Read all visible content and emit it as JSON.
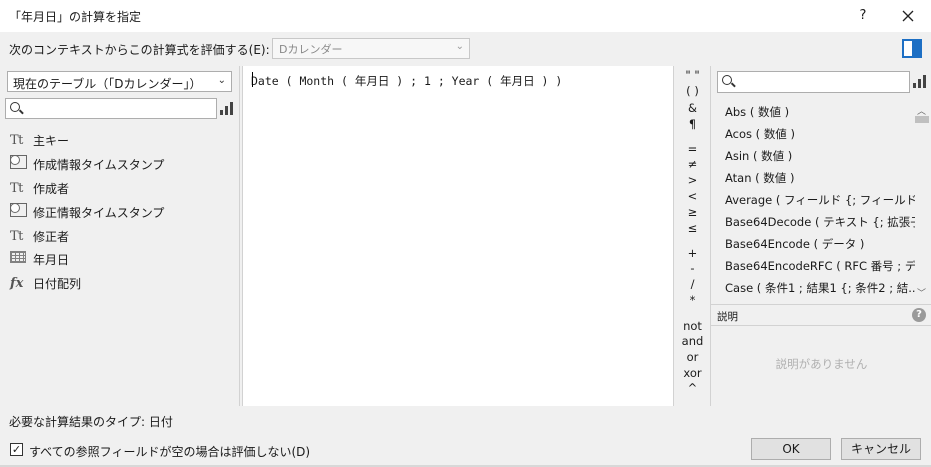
{
  "window": {
    "title": "「年月日」の計算を指定",
    "help_label": "?",
    "close_label": "✕"
  },
  "context": {
    "label": "次のコンテキストからこの計算式を評価する(E):",
    "value": "Dカレンダー"
  },
  "left_panel": {
    "table_select": "現在のテーブル（「Dカレンダー」）",
    "search_placeholder": "",
    "fields": [
      {
        "icon": "text-field-icon",
        "icon_text": "Tt",
        "label": "主キー"
      },
      {
        "icon": "timestamp-field-icon",
        "icon_text": "",
        "label": "作成情報タイムスタンプ"
      },
      {
        "icon": "text-field-icon",
        "icon_text": "Tt",
        "label": "作成者"
      },
      {
        "icon": "timestamp-field-icon",
        "icon_text": "",
        "label": "修正情報タイムスタンプ"
      },
      {
        "icon": "text-field-icon",
        "icon_text": "Tt",
        "label": "修正者"
      },
      {
        "icon": "date-field-icon",
        "icon_text": "",
        "label": "年月日"
      },
      {
        "icon": "calculation-field-icon",
        "icon_text": "fx",
        "label": "日付配列"
      }
    ]
  },
  "editor": {
    "formula": "Date ( Month ( 年月日 ) ; 1 ; Year ( 年月日 ) )"
  },
  "operators": [
    "\" \"",
    "( )",
    "&",
    "¶",
    "=",
    "≠",
    ">",
    "<",
    "≥",
    "≤",
    "+",
    "-",
    "/",
    "*",
    "not",
    "and",
    "or",
    "xor",
    "^"
  ],
  "right_panel": {
    "search_placeholder": "",
    "functions": [
      "Abs ( 数値 )",
      "Acos ( 数値 )",
      "Asin ( 数値 )",
      "Atan ( 数値 )",
      "Average ( フィールド {; フィールド...} )",
      "Base64Decode ( テキスト {; 拡張子...",
      "Base64Encode ( データ )",
      "Base64EncodeRFC ( RFC 番号 ; デ...",
      "Case ( 条件1 ; 結果1 {; 条件2 ; 結..."
    ],
    "description_label": "説明",
    "description_help": "?",
    "description_empty": "説明がありません"
  },
  "footer": {
    "result_type": "必要な計算結果のタイプ: 日付",
    "skip_label": "すべての参照フィールドが空の場合は評価しない(D)",
    "skip_checked": true,
    "ok_label": "OK",
    "cancel_label": "キャンセル"
  }
}
